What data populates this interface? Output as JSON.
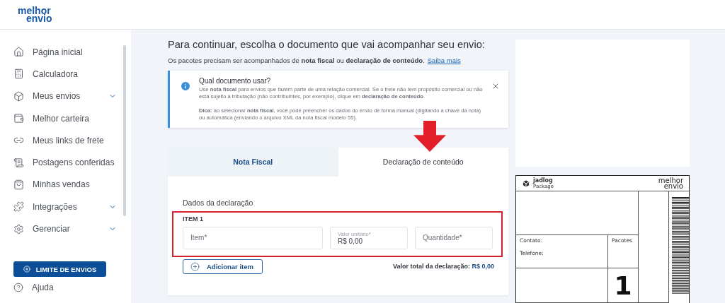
{
  "brand": {
    "line1": "melhor",
    "line2": "envio"
  },
  "sidebar": {
    "items": [
      {
        "label": "Página inicial",
        "expandable": false
      },
      {
        "label": "Calculadora",
        "expandable": false
      },
      {
        "label": "Meus envios",
        "expandable": true
      },
      {
        "label": "Melhor carteira",
        "expandable": false
      },
      {
        "label": "Meus links de frete",
        "expandable": false
      },
      {
        "label": "Postagens conferidas",
        "expandable": false
      },
      {
        "label": "Minhas vendas",
        "expandable": false
      },
      {
        "label": "Integrações",
        "expandable": true
      },
      {
        "label": "Gerenciar",
        "expandable": true
      }
    ],
    "limit_button": "LIMITE DE ENVIOS",
    "help": "Ajuda"
  },
  "main": {
    "title": "Para continuar, escolha o documento que vai acompanhar seu envio:",
    "subtitle": "Os pacotes precisam ser acompanhados de **nota fiscal** ou **declaração de conteúdo**.",
    "subtitle_link": "Saiba mais",
    "info": {
      "title": "Qual documento usar?",
      "text": "Use **nota fiscal** para envios que fazem parte de uma relação comercial. Se o frete não tem propósito comercial ou não está sujeito à tributação (não contribuintes, por exemplo), clique em **declaração de conteúdo**.",
      "tip": "**Dica:** ao selecionar **nota fiscal**, você pode preencher os dados do envio de forma manual (digitando a chave da nota) ou automática (enviando o arquivo XML da nota fiscal modelo 55)."
    },
    "tabs": [
      {
        "label": "Nota Fiscal",
        "selected": false
      },
      {
        "label": "Declaração de conteúdo",
        "selected": true
      }
    ],
    "section_title": "Dados da declaração",
    "item_group": {
      "title": "ITEM 1",
      "highlighted": true,
      "fields": [
        {
          "placeholder": "Item*"
        },
        {
          "label": "Valor unitário*",
          "value": "R$ 0,00"
        },
        {
          "placeholder": "Quantidade*"
        }
      ]
    },
    "add_button": "Adicionar item",
    "total_label": "Valor total da declaração:",
    "total_value": "R$ 0,00"
  },
  "label_preview": {
    "carrier": "jadlog",
    "carrier_sub": "Package",
    "brand_line1": "melhor",
    "brand_line2": "envio",
    "contact": "Contato:",
    "phone": "Telefone:",
    "packages": "Pacotes",
    "count": "1"
  }
}
